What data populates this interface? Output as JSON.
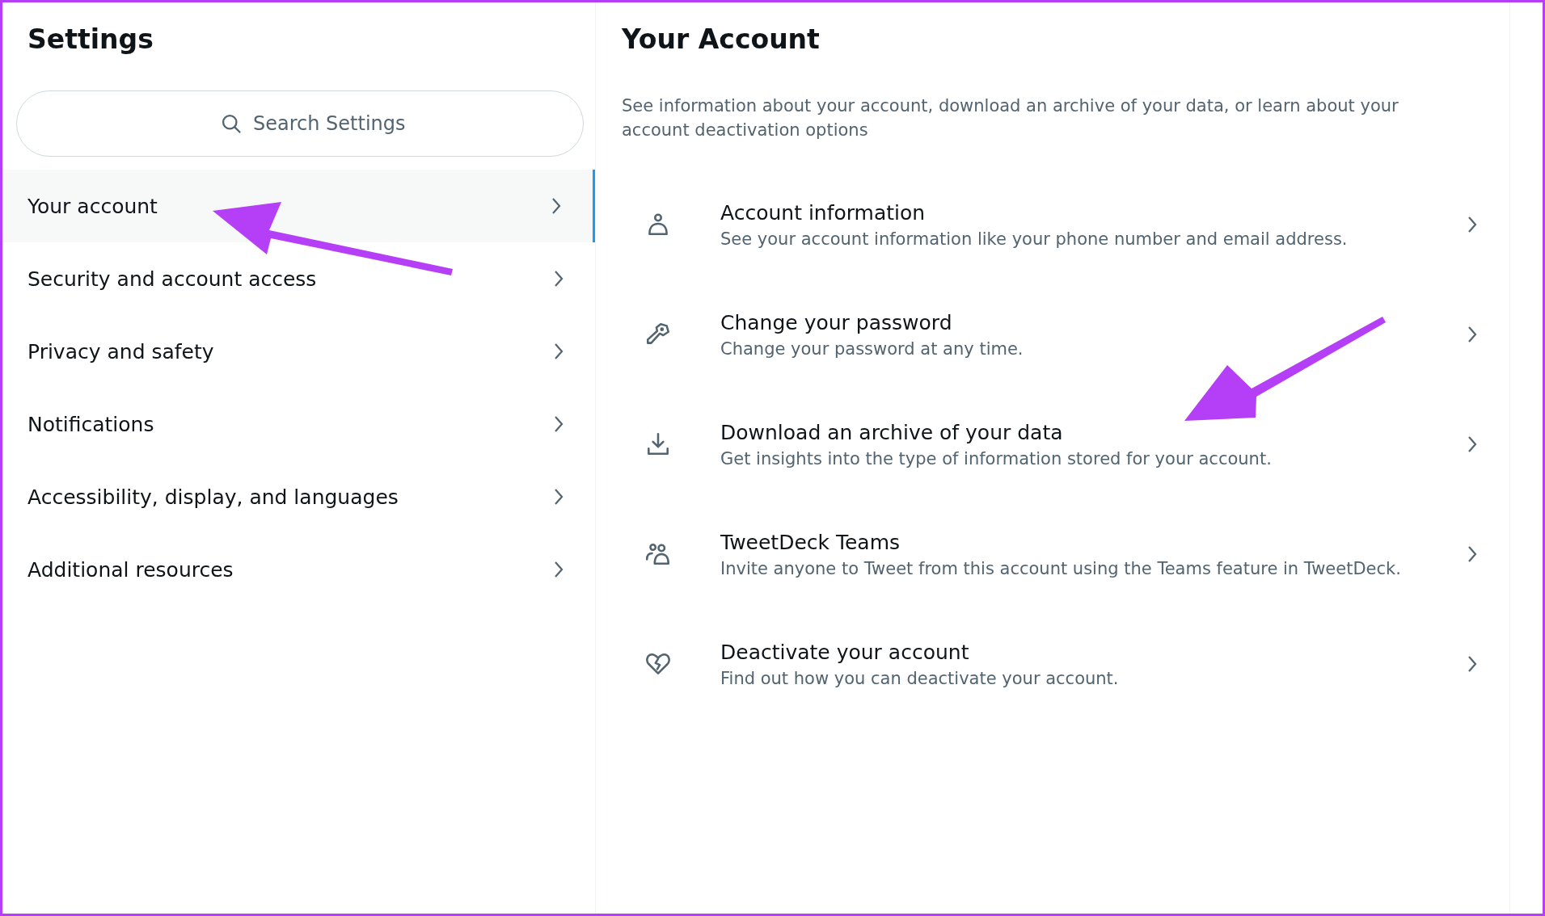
{
  "sidebar": {
    "title": "Settings",
    "search": {
      "placeholder": "Search Settings"
    },
    "items": [
      {
        "label": "Your account",
        "selected": true
      },
      {
        "label": "Security and account access",
        "selected": false
      },
      {
        "label": "Privacy and safety",
        "selected": false
      },
      {
        "label": "Notifications",
        "selected": false
      },
      {
        "label": "Accessibility, display, and languages",
        "selected": false
      },
      {
        "label": "Additional resources",
        "selected": false
      }
    ]
  },
  "main": {
    "title": "Your Account",
    "description": "See information about your account, download an archive of your data, or learn about your account deactivation options",
    "items": [
      {
        "kind": "person",
        "title": "Account information",
        "subtitle": "See your account information like your phone number and email address."
      },
      {
        "kind": "key",
        "title": "Change your password",
        "subtitle": "Change your password at any time."
      },
      {
        "kind": "download",
        "title": "Download an archive of your data",
        "subtitle": "Get insights into the type of information stored for your account."
      },
      {
        "kind": "team",
        "title": "TweetDeck Teams",
        "subtitle": "Invite anyone to Tweet from this account using the Teams feature in TweetDeck."
      },
      {
        "kind": "heart",
        "title": "Deactivate your account",
        "subtitle": "Find out how you can deactivate your account."
      }
    ]
  }
}
